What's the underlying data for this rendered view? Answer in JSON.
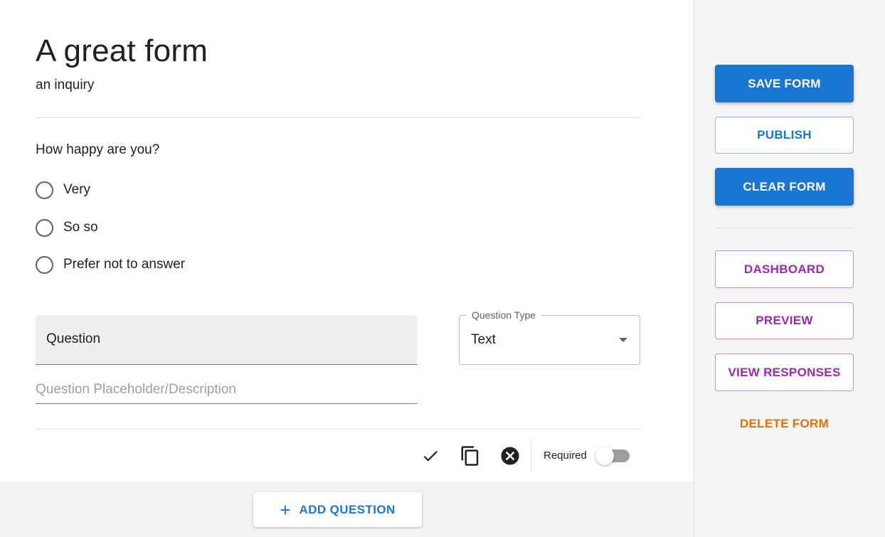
{
  "form": {
    "title": "A great form",
    "subtitle": "an inquiry"
  },
  "question": {
    "label": "How happy are you?",
    "options": [
      "Very",
      "So so",
      "Prefer not to answer"
    ]
  },
  "editor": {
    "question_label": "Question",
    "description_placeholder": "Question Placeholder/Description",
    "type_legend": "Question Type",
    "type_value": "Text",
    "required_label": "Required",
    "required_on": false,
    "icons": [
      "check-icon",
      "copy-icon",
      "delete-circle-icon"
    ]
  },
  "add_question": {
    "plus": "+",
    "label": "ADD QUESTION"
  },
  "sidebar": {
    "save": "SAVE FORM",
    "publish": "PUBLISH",
    "clear": "CLEAR FORM",
    "dashboard": "DASHBOARD",
    "preview": "PREVIEW",
    "view_responses": "VIEW RESPONSES",
    "delete": "DELETE FORM"
  },
  "colors": {
    "primary": "#1976d2",
    "secondary": "#9c27b0",
    "warning": "#ed6c02"
  }
}
